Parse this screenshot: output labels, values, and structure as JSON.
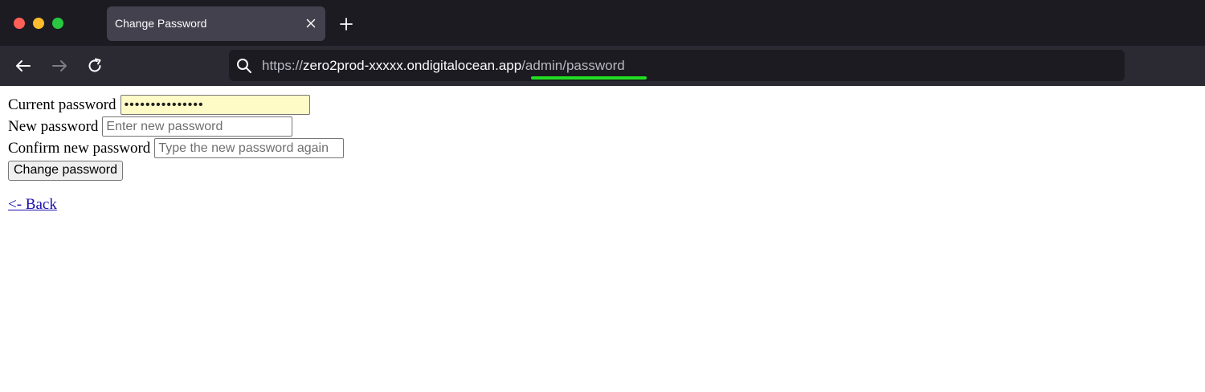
{
  "browser": {
    "tab_title": "Change Password",
    "url": {
      "scheme": "https://",
      "host": "zero2prod-xxxxx.ondigitalocean.app",
      "path": "/admin/password"
    },
    "colors": {
      "chrome_bg": "#1c1b22",
      "toolbar_bg": "#2b2a33",
      "tab_bg": "#42414d",
      "highlight_underline": "#22dd22"
    }
  },
  "form": {
    "current_password": {
      "label": "Current password",
      "value": "•••••••••••••••"
    },
    "new_password": {
      "label": "New password",
      "placeholder": "Enter new password"
    },
    "confirm_password": {
      "label": "Confirm new password",
      "placeholder": "Type the new password again"
    },
    "submit_label": "Change password"
  },
  "back_link": "<- Back",
  "icons": {
    "tab_close": "close-icon",
    "new_tab": "plus-icon",
    "back": "arrow-left-icon",
    "forward": "arrow-right-icon",
    "reload": "reload-icon",
    "search": "search-icon"
  }
}
